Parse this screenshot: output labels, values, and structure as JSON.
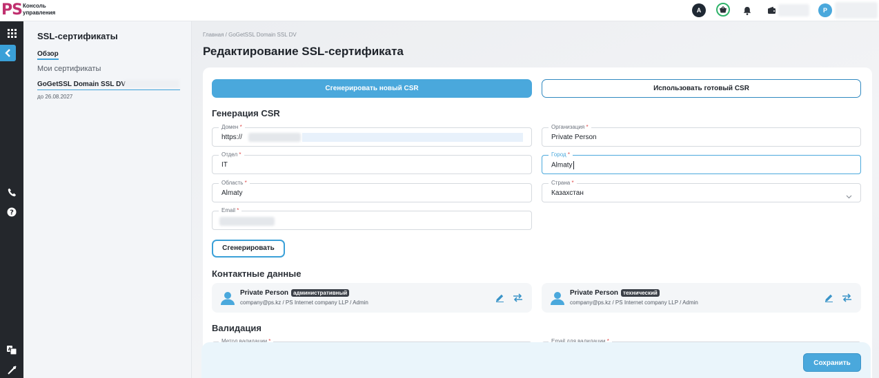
{
  "app": {
    "logo_mark": "PS",
    "logo_text": "Консоль управления"
  },
  "topbar": {
    "avatar_a": "A",
    "avatar_p": "P"
  },
  "sidebar": {
    "title": "SSL-сертификаты",
    "items": [
      {
        "label": "Обзор",
        "active": true
      },
      {
        "label": "Мои сертификаты",
        "active": false
      }
    ],
    "certificate": {
      "name": "GoGetSSL Domain SSL DV",
      "expires": "до 26.08.2027"
    }
  },
  "breadcrumbs": "Главная  /  GoGetSSL Domain SSL DV",
  "page_title": "Редактирование SSL-сертификата",
  "csr_tabs": {
    "generate": "Сгенерировать новый CSR",
    "use_ready": "Использовать готовый CSR"
  },
  "csr_section": {
    "title": "Генерация CSR",
    "fields": {
      "domain": {
        "label": "Домен",
        "value": "https://"
      },
      "organization": {
        "label": "Организация",
        "value": "Private Person"
      },
      "department": {
        "label": "Отдел",
        "value": "IT"
      },
      "city": {
        "label": "Город",
        "value": "Almaty"
      },
      "region": {
        "label": "Область",
        "value": "Almaty"
      },
      "country": {
        "label": "Страна",
        "value": "Казахстан"
      },
      "email": {
        "label": "Email",
        "value": ""
      }
    },
    "generate_button": "Сгенерировать"
  },
  "contacts_section": {
    "title": "Контактные данные",
    "contacts": [
      {
        "name": "Private Person",
        "role": "административный",
        "details": "company@ps.kz / PS Internet company LLP / Admin"
      },
      {
        "name": "Private Person",
        "role": "технический",
        "details": "company@ps.kz / PS Internet company LLP / Admin"
      }
    ]
  },
  "validation_section": {
    "title": "Валидация",
    "method_label": "Метод валидации",
    "email_label": "Email для валидации"
  },
  "save_button": "Сохранить",
  "colors": {
    "accent": "#4aa8dc",
    "rail": "#24272c",
    "brand": "#c0306f",
    "required": "#e04a4a"
  }
}
